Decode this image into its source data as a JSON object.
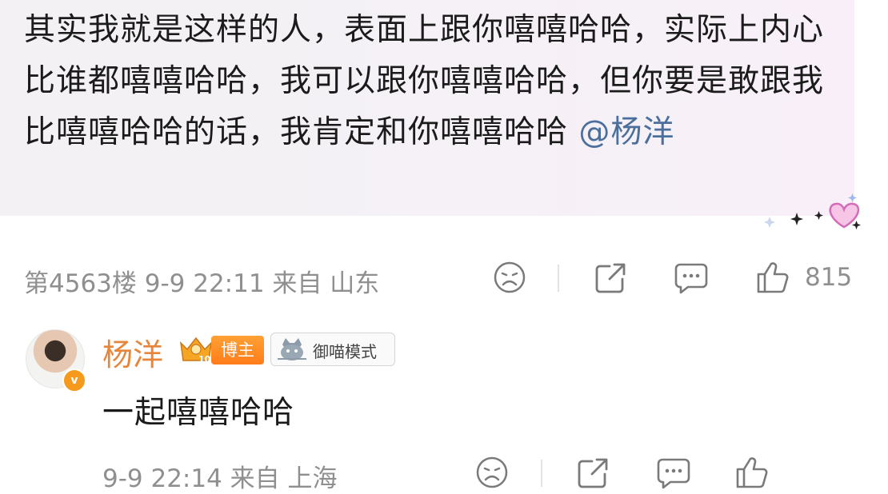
{
  "comment": {
    "text": "其实我就是这样的人，表面上跟你嘻嘻哈哈，实际上内心比谁都嘻嘻哈哈，我可以跟你嘻嘻哈哈，但你要是敢跟我比嘻嘻哈哈的话，我肯定和你嘻嘻哈哈",
    "mention": "@杨洋",
    "meta": "第4563楼  9-9 22:11  来自 山东",
    "like_count": "815"
  },
  "reply": {
    "username": "杨洋",
    "blogger_tag": "博主",
    "crown_level": "10",
    "verified_mark": "v",
    "mode_tag": "御喵模式",
    "text": "一起嘻嘻哈哈",
    "meta": "9-9 22:14  来自 上海"
  },
  "icons": [
    "sad-face-icon",
    "share-icon",
    "comment-icon",
    "thumbs-up-icon",
    "verified-icon",
    "crown-icon",
    "cat-icon",
    "sparkle-heart-icon"
  ],
  "colors": {
    "username": "#e7853a",
    "mention": "#4b6f9d",
    "meta_gray": "#8f8f8f",
    "blogger_tag": "#ff8a22",
    "verified": "#f59a1c"
  }
}
